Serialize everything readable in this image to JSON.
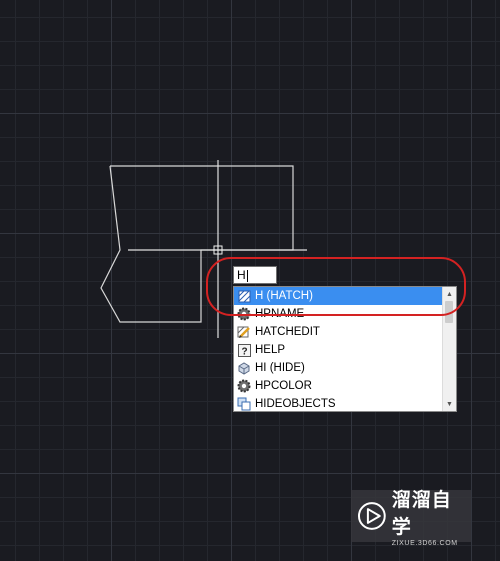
{
  "command_input": {
    "value": "H"
  },
  "autocomplete": {
    "items": [
      {
        "label": "H (HATCH)",
        "icon": "hatch-icon",
        "selected": true
      },
      {
        "label": "HPNAME",
        "icon": "gear-icon",
        "selected": false
      },
      {
        "label": "HATCHEDIT",
        "icon": "hatch-edit-icon",
        "selected": false
      },
      {
        "label": "HELP",
        "icon": "help-icon",
        "selected": false
      },
      {
        "label": "HI (HIDE)",
        "icon": "hide-icon",
        "selected": false
      },
      {
        "label": "HPCOLOR",
        "icon": "gear-icon",
        "selected": false
      },
      {
        "label": "HIDEOBJECTS",
        "icon": "hide-objects-icon",
        "selected": false
      }
    ]
  },
  "colors": {
    "canvas_bg": "#1a1b21",
    "selection": "#3a8ef0",
    "annotation": "#d42222"
  },
  "watermark": {
    "title": "溜溜自学",
    "url": "ZIXUE.3D66.COM"
  }
}
